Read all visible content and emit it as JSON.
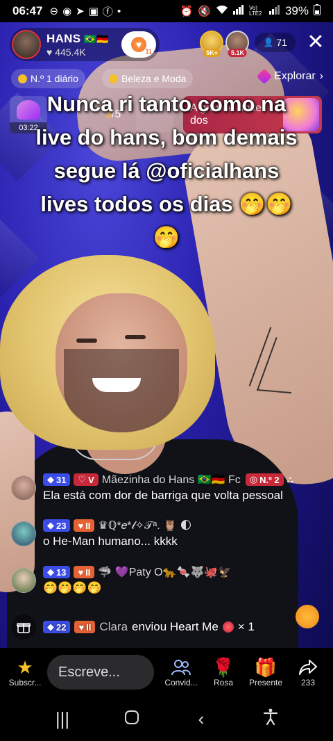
{
  "status_bar": {
    "time": "06:47",
    "battery": "39%",
    "network": "Vo) LTE2"
  },
  "host": {
    "name": "HANS",
    "flags": "🇧🇷🇩🇪",
    "likes": "♥ 445.4K",
    "follow_badge": "11"
  },
  "top_right": {
    "viewer1_tag": "5K+",
    "viewer2_tag": "5.1K",
    "viewer_count": "71"
  },
  "chips": {
    "daily_rank": "N.º 1 diário",
    "category": "Beleza e Moda",
    "explore": "Explorar"
  },
  "event": {
    "timer": "03:22",
    "pager_current": "3",
    "pager_total": "/5",
    "banner_text": "A grande noite dos"
  },
  "caption": "Nunca ri tanto como na live do hans, bom demais segue lá @oficialhans lives todos os dias 🤭🤭🤭",
  "chat": [
    {
      "level": "31",
      "badge2": "V",
      "username": "Mãezinha do Hans 🇧🇷🇩🇪 Fc",
      "badge3": "N.º 2",
      "message": "Ela está com dor de barriga que volta pessoal"
    },
    {
      "level": "23",
      "badge2": "II",
      "username": "♛ℚ*𝑒*𝓁✧𝒯ᵃ. 🦉 🌓",
      "message": "o He-Man humano... kkkk"
    },
    {
      "level": "13",
      "badge2": "II",
      "username": "🦈 💜Paty O🐆🍬🐺🐙🦅",
      "message": "🤭🤭🤭🤭"
    }
  ],
  "gift": {
    "level": "22",
    "badge2": "II",
    "who": "Clara",
    "text": "enviou Heart Me",
    "count": "× 1"
  },
  "toolbar": {
    "subscribe": "Subscr...",
    "compose_placeholder": "Escreve...",
    "invite": "Convid...",
    "rose": "Rosa",
    "gift": "Presente",
    "share_count": "233"
  },
  "colors": {
    "accent_gold": "#f4c12b",
    "level_blue": "#3b4de6",
    "badge_orange": "#e56236",
    "banner_red": "#c62a3a"
  }
}
